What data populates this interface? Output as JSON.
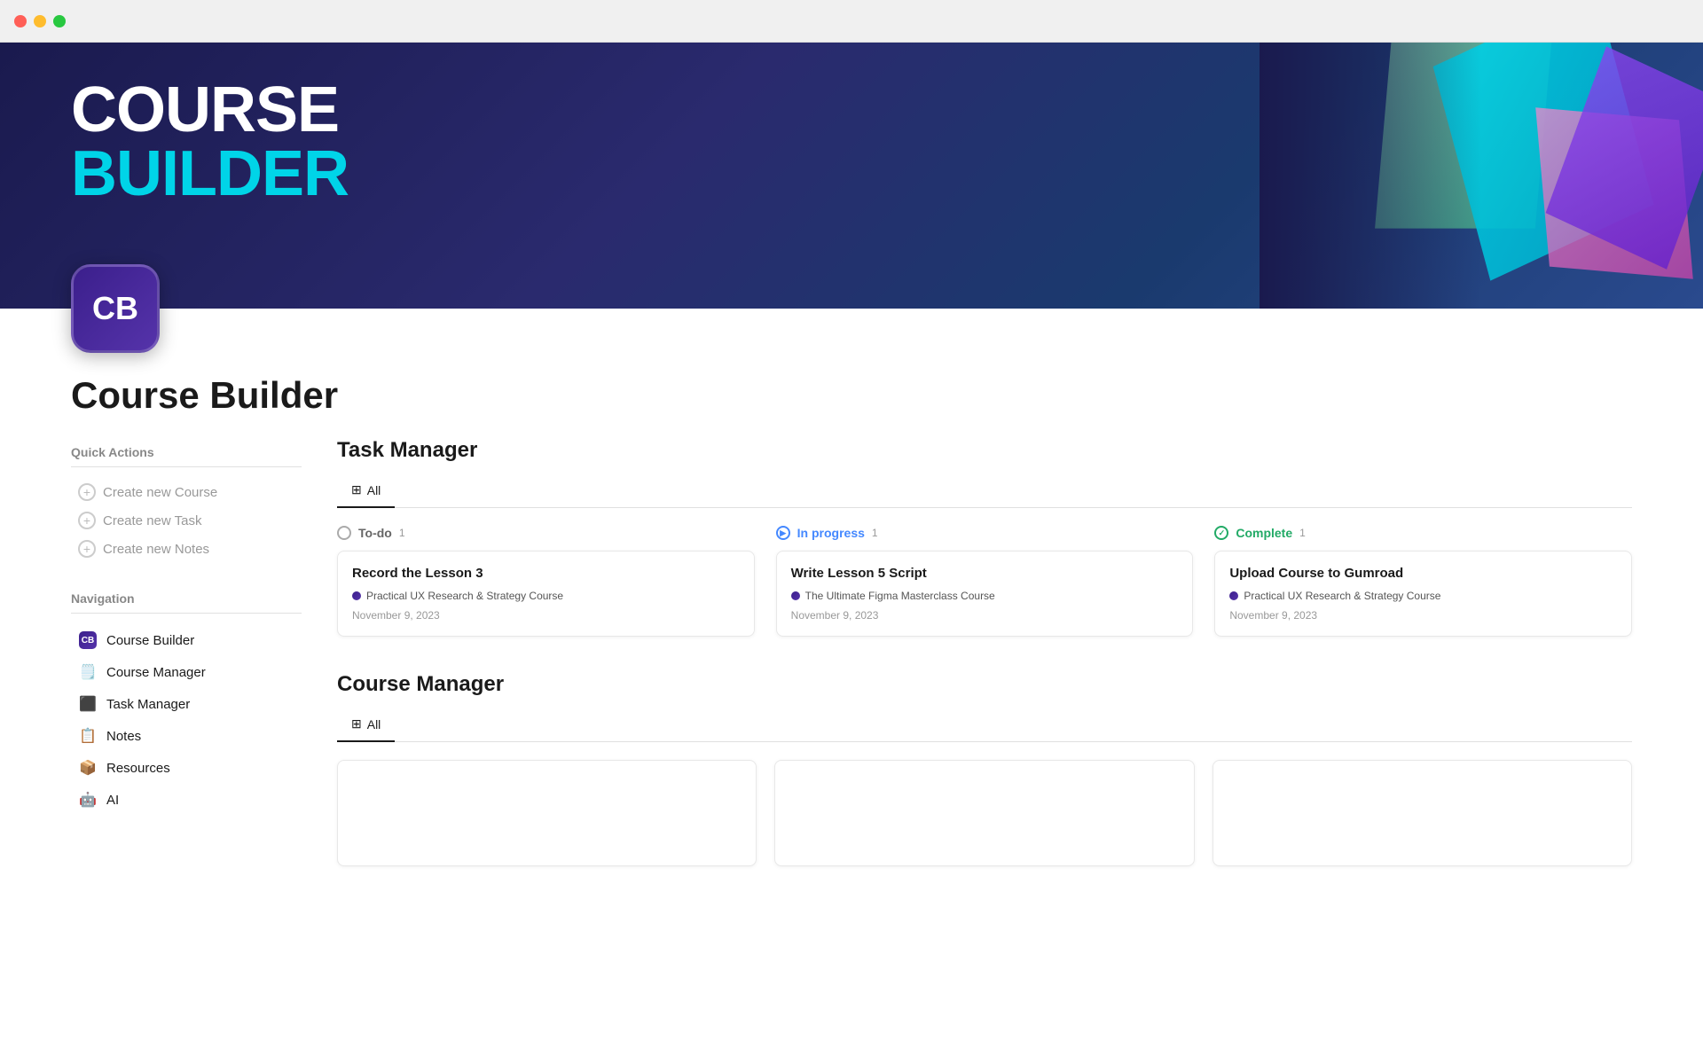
{
  "titlebar": {
    "btn_red": "close",
    "btn_yellow": "minimize",
    "btn_green": "maximize"
  },
  "hero": {
    "title_line1": "COURSE",
    "title_line2": "BUILDER"
  },
  "app_icon": {
    "letters": "CB"
  },
  "page_title": "Course Builder",
  "quick_actions": {
    "section_title": "Quick Actions",
    "items": [
      {
        "label": "Create new Course"
      },
      {
        "label": "Create new Task"
      },
      {
        "label": "Create new Notes"
      }
    ]
  },
  "navigation": {
    "section_title": "Navigation",
    "items": [
      {
        "icon": "🟣",
        "label": "Course Builder"
      },
      {
        "icon": "🗒️",
        "label": "Course Manager"
      },
      {
        "icon": "⬛",
        "label": "Task Manager"
      },
      {
        "icon": "📋",
        "label": "Notes"
      },
      {
        "icon": "📦",
        "label": "Resources"
      },
      {
        "icon": "🤖",
        "label": "AI"
      }
    ]
  },
  "task_manager": {
    "title": "Task Manager",
    "tabs": [
      {
        "label": "All",
        "active": true
      }
    ],
    "columns": [
      {
        "status": "todo",
        "label": "To-do",
        "count": 1,
        "tasks": [
          {
            "title": "Record the Lesson 3",
            "course": "Practical UX Research & Strategy Course",
            "date": "November 9, 2023"
          }
        ]
      },
      {
        "status": "inprogress",
        "label": "In progress",
        "count": 1,
        "tasks": [
          {
            "title": "Write Lesson 5 Script",
            "course": "The Ultimate Figma Masterclass Course",
            "date": "November 9, 2023"
          }
        ]
      },
      {
        "status": "complete",
        "label": "Complete",
        "count": 1,
        "tasks": [
          {
            "title": "Upload Course to Gumroad",
            "course": "Practical UX Research & Strategy Course",
            "date": "November 9, 2023"
          }
        ]
      }
    ]
  },
  "course_manager": {
    "title": "Course Manager",
    "tabs": [
      {
        "label": "All",
        "active": true
      }
    ]
  }
}
